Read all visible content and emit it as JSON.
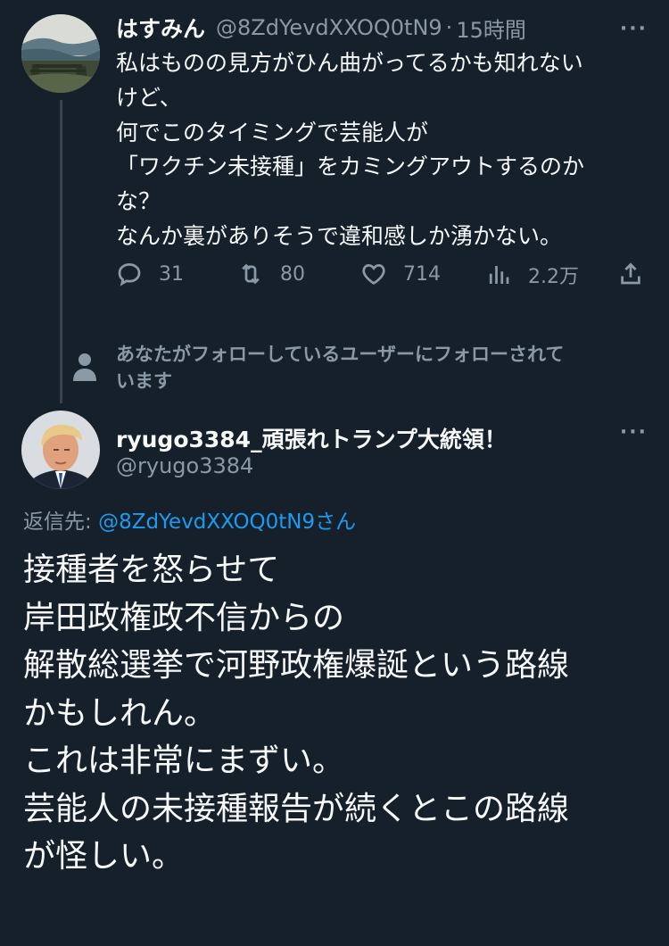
{
  "tweet1": {
    "display_name": "はすみん",
    "handle": "@8ZdYevdXXOQ0tN9",
    "separator": "·",
    "time": "15時間",
    "more": "···",
    "lines": [
      "私はものの見方がひん曲がってるかも知れない",
      "けど、",
      "何でこのタイミングで芸能人が",
      "「ワクチン未接種」をカミングアウトするのか",
      "な？",
      "なんか裏がありそうで違和感しか湧かない。"
    ],
    "actions": {
      "replies": "31",
      "retweets": "80",
      "likes": "714",
      "views": "2.2万"
    }
  },
  "followed_notice": {
    "lines": [
      "あなたがフォローしているユーザーにフォローされて",
      "います"
    ]
  },
  "tweet2": {
    "display_name": "ryugo3384_頑張れトランプ大統領！",
    "handle": "@ryugo3384",
    "more": "···",
    "reply_prefix": "返信先: ",
    "reply_to": "@8ZdYevdXXOQ0tN9",
    "reply_suffix": "さん",
    "lines": [
      "接種者を怒らせて",
      "岸田政権政不信からの",
      "解散総選挙で河野政権爆誕という路線",
      "かもしれん。",
      "これは非常にまずい。",
      "芸能人の未接種報告が続くとこの路線",
      "が怪しい。"
    ]
  },
  "colors": {
    "background": "#15202b",
    "text": "#f7f9f9",
    "secondary": "#8b98a5",
    "link": "#1d9bf0",
    "thread_line": "#38444d"
  }
}
